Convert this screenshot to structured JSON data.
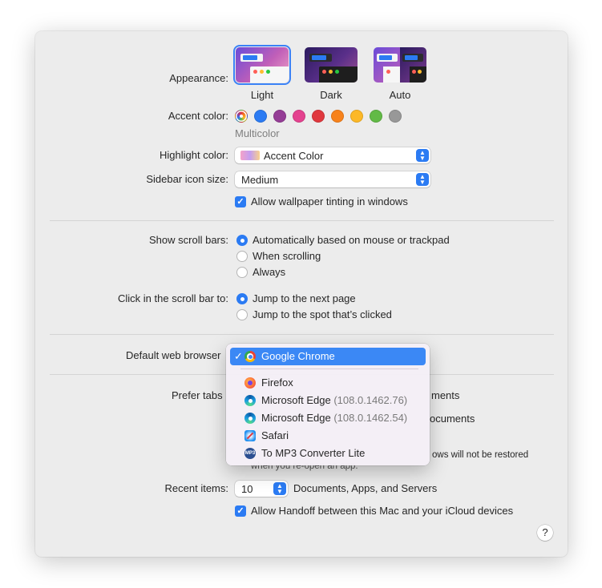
{
  "appearance": {
    "label": "Appearance:",
    "options": [
      {
        "name": "Light",
        "selected": true
      },
      {
        "name": "Dark",
        "selected": false
      },
      {
        "name": "Auto",
        "selected": false
      }
    ]
  },
  "accent": {
    "label": "Accent color:",
    "selected_name": "Multicolor",
    "colors": [
      "multicolor",
      "#2b7bf3",
      "#953d96",
      "#e4428f",
      "#e0383e",
      "#f7821b",
      "#fcb827",
      "#62ba46",
      "#989898"
    ]
  },
  "highlight": {
    "label": "Highlight color:",
    "value": "Accent Color"
  },
  "sidebar_icon": {
    "label": "Sidebar icon size:",
    "value": "Medium"
  },
  "wallpaper_tinting": {
    "label": "Allow wallpaper tinting in windows",
    "checked": true
  },
  "scroll_bars": {
    "label": "Show scroll bars:",
    "options": [
      {
        "label": "Automatically based on mouse or trackpad",
        "selected": true
      },
      {
        "label": "When scrolling",
        "selected": false
      },
      {
        "label": "Always",
        "selected": false
      }
    ]
  },
  "click_scroll": {
    "label": "Click in the scroll bar to:",
    "options": [
      {
        "label": "Jump to the next page",
        "selected": true
      },
      {
        "label": "Jump to the spot that’s clicked",
        "selected": false
      }
    ]
  },
  "default_browser": {
    "label": "Default web browser",
    "menu": [
      {
        "name": "Google Chrome",
        "version": "",
        "checked": true,
        "icon": "chrome-icon"
      },
      {
        "name": "Firefox",
        "version": "",
        "checked": false,
        "icon": "firefox-icon"
      },
      {
        "name": "Microsoft Edge",
        "version": "(108.0.1462.76)",
        "checked": false,
        "icon": "edge-icon"
      },
      {
        "name": "Microsoft Edge",
        "version": "(108.0.1462.54)",
        "checked": false,
        "icon": "edge-icon"
      },
      {
        "name": "Safari",
        "version": "",
        "checked": false,
        "icon": "safari-icon"
      },
      {
        "name": "To MP3 Converter Lite",
        "version": "",
        "checked": false,
        "icon": "mp3-converter-icon"
      }
    ],
    "check_mark": "✓"
  },
  "prefer_tabs": {
    "label": "Prefer tabs",
    "tail": "ments"
  },
  "hidden_row_tail": "ocuments",
  "restore_note": {
    "tail1": "ows will not be restored",
    "line2": "when you re-open an app."
  },
  "recent_items": {
    "label": "Recent items:",
    "value": "10",
    "suffix": "Documents, Apps, and Servers"
  },
  "handoff": {
    "label": "Allow Handoff between this Mac and your iCloud devices",
    "checked": true
  },
  "help": {
    "label": "?"
  }
}
